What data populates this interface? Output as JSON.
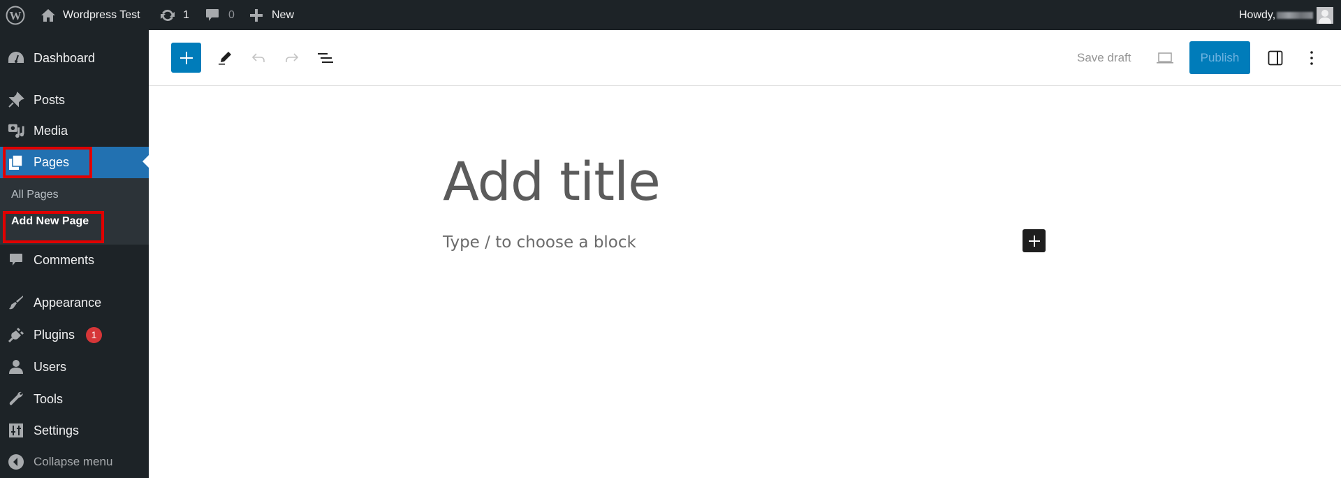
{
  "admin_bar": {
    "wp_logo": "wordpress-logo-icon",
    "site_name": "Wordpress Test",
    "updates_count": "1",
    "comments_count": "0",
    "new_label": "New",
    "howdy_label": "Howdy,"
  },
  "sidebar": {
    "items": [
      {
        "label": "Dashboard",
        "icon": "dashboard-icon"
      },
      {
        "label": "Posts",
        "icon": "pin-icon"
      },
      {
        "label": "Media",
        "icon": "media-icon"
      },
      {
        "label": "Pages",
        "icon": "pages-icon",
        "current": true
      },
      {
        "label": "Comments",
        "icon": "comment-icon"
      },
      {
        "label": "Appearance",
        "icon": "brush-icon"
      },
      {
        "label": "Plugins",
        "icon": "plugin-icon",
        "badge": "1"
      },
      {
        "label": "Users",
        "icon": "user-icon"
      },
      {
        "label": "Tools",
        "icon": "wrench-icon"
      },
      {
        "label": "Settings",
        "icon": "settings-icon"
      },
      {
        "label": "Collapse menu",
        "icon": "collapse-icon"
      }
    ],
    "submenu": [
      {
        "label": "All Pages"
      },
      {
        "label": "Add New Page",
        "current": true
      }
    ]
  },
  "editor": {
    "toolbar": {
      "save_draft_label": "Save draft",
      "publish_label": "Publish"
    },
    "title_placeholder": "Add title",
    "block_placeholder": "Type / to choose a block"
  },
  "colors": {
    "admin_dark": "#1d2327",
    "accent_blue": "#2271b1",
    "button_blue": "#007cba",
    "highlight_red": "#e00000",
    "badge_red": "#d63638"
  }
}
